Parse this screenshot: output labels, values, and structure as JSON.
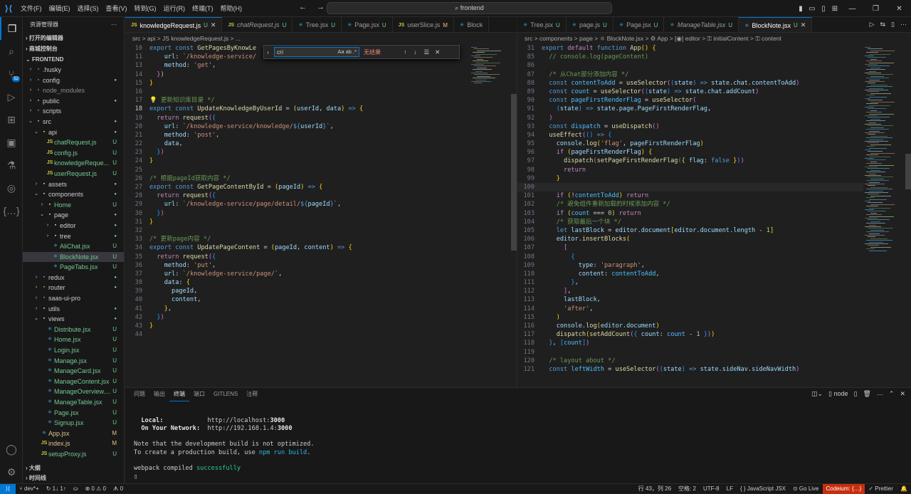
{
  "titlebar": {
    "menu": [
      "文件(F)",
      "编辑(E)",
      "选择(S)",
      "查看(V)",
      "转到(G)",
      "运行(R)",
      "终端(T)",
      "帮助(H)"
    ],
    "search": "frontend"
  },
  "activity": {
    "badge": "52"
  },
  "sidebar": {
    "title": "资源管理器",
    "sections": {
      "open_editors": "打开的编辑器",
      "workspace": "商城控制台",
      "project": "FRONTEND",
      "outline": "大纲",
      "timeline": "时间线"
    },
    "tree": [
      {
        "d": 0,
        "a": ">",
        "i": "▪",
        "ic": "#6d8086",
        "l": ".husky",
        "s": ""
      },
      {
        "d": 0,
        "a": ">",
        "i": "▪",
        "ic": "#6d8086",
        "l": "config",
        "s": "dot"
      },
      {
        "d": 0,
        "a": ">",
        "i": "▪",
        "ic": "#6d8086",
        "l": "node_modules",
        "s": "",
        "cls": "dim"
      },
      {
        "d": 0,
        "a": ">",
        "i": "▪",
        "ic": "#73c991",
        "l": "public",
        "s": "dot"
      },
      {
        "d": 0,
        "a": ">",
        "i": "▪",
        "ic": "#6d8086",
        "l": "scripts",
        "s": ""
      },
      {
        "d": 0,
        "a": "v",
        "i": "▪",
        "ic": "#73c991",
        "l": "src",
        "s": "dot"
      },
      {
        "d": 1,
        "a": "v",
        "i": "▪",
        "ic": "#cbcb41",
        "l": "api",
        "s": "dot"
      },
      {
        "d": 2,
        "a": "",
        "i": "JS",
        "ic": "#cbcb41",
        "l": "chatRequest.js",
        "s": "U",
        "cls": "U"
      },
      {
        "d": 2,
        "a": "",
        "i": "JS",
        "ic": "#cbcb41",
        "l": "config.js",
        "s": "U",
        "cls": "U"
      },
      {
        "d": 2,
        "a": "",
        "i": "JS",
        "ic": "#cbcb41",
        "l": "knowledgeReque...",
        "s": "U",
        "cls": "U"
      },
      {
        "d": 2,
        "a": "",
        "i": "JS",
        "ic": "#cbcb41",
        "l": "userRequest.js",
        "s": "U",
        "cls": "U"
      },
      {
        "d": 1,
        "a": ">",
        "i": "▪",
        "ic": "#e2c08d",
        "l": "assets",
        "s": "dot"
      },
      {
        "d": 1,
        "a": "v",
        "i": "▪",
        "ic": "#e2c08d",
        "l": "components",
        "s": "dot"
      },
      {
        "d": 2,
        "a": ">",
        "i": "▪",
        "ic": "#e2c08d",
        "l": "Home",
        "s": "U",
        "cls": "U"
      },
      {
        "d": 2,
        "a": "v",
        "i": "▪",
        "ic": "#e2c08d",
        "l": "page",
        "s": "dot"
      },
      {
        "d": 3,
        "a": ">",
        "i": "▪",
        "ic": "#e2c08d",
        "l": "editor",
        "s": "dot"
      },
      {
        "d": 3,
        "a": ">",
        "i": "▪",
        "ic": "#e2c08d",
        "l": "tree",
        "s": "dot"
      },
      {
        "d": 3,
        "a": "",
        "i": "⚛",
        "ic": "#4fc1ff",
        "l": "AliChat.jsx",
        "s": "U",
        "cls": "U"
      },
      {
        "d": 3,
        "a": "",
        "i": "⚛",
        "ic": "#4fc1ff",
        "l": "BlockNote.jsx",
        "s": "U",
        "cls": "U",
        "sel": true
      },
      {
        "d": 3,
        "a": "",
        "i": "⚛",
        "ic": "#4fc1ff",
        "l": "PageTabs.jsx",
        "s": "U",
        "cls": "U"
      },
      {
        "d": 1,
        "a": ">",
        "i": "▪",
        "ic": "#a074c4",
        "l": "redux",
        "s": "dot"
      },
      {
        "d": 1,
        "a": ">",
        "i": "▪",
        "ic": "#e37933",
        "l": "router",
        "s": "dot"
      },
      {
        "d": 1,
        "a": ">",
        "i": "▪",
        "ic": "#6d8086",
        "l": "saas-ui-pro",
        "s": ""
      },
      {
        "d": 1,
        "a": ">",
        "i": "▪",
        "ic": "#e2c08d",
        "l": "utils",
        "s": "dot"
      },
      {
        "d": 1,
        "a": "v",
        "i": "▪",
        "ic": "#e2c08d",
        "l": "views",
        "s": "dot"
      },
      {
        "d": 2,
        "a": "",
        "i": "⚛",
        "ic": "#4fc1ff",
        "l": "Distribute.jsx",
        "s": "U",
        "cls": "U"
      },
      {
        "d": 2,
        "a": "",
        "i": "⚛",
        "ic": "#4fc1ff",
        "l": "Home.jsx",
        "s": "U",
        "cls": "U"
      },
      {
        "d": 2,
        "a": "",
        "i": "⚛",
        "ic": "#4fc1ff",
        "l": "Login.jsx",
        "s": "U",
        "cls": "U"
      },
      {
        "d": 2,
        "a": "",
        "i": "⚛",
        "ic": "#4fc1ff",
        "l": "Manage.jsx",
        "s": "U",
        "cls": "U"
      },
      {
        "d": 2,
        "a": "",
        "i": "⚛",
        "ic": "#4fc1ff",
        "l": "ManageCard.jsx",
        "s": "U",
        "cls": "U"
      },
      {
        "d": 2,
        "a": "",
        "i": "⚛",
        "ic": "#4fc1ff",
        "l": "ManageContent.jsx",
        "s": "U",
        "cls": "U"
      },
      {
        "d": 2,
        "a": "",
        "i": "⚛",
        "ic": "#4fc1ff",
        "l": "ManageOverview....",
        "s": "U",
        "cls": "U"
      },
      {
        "d": 2,
        "a": "",
        "i": "⚛",
        "ic": "#4fc1ff",
        "l": "ManageTable.jsx",
        "s": "U",
        "cls": "U"
      },
      {
        "d": 2,
        "a": "",
        "i": "⚛",
        "ic": "#4fc1ff",
        "l": "Page.jsx",
        "s": "U",
        "cls": "U"
      },
      {
        "d": 2,
        "a": "",
        "i": "⚛",
        "ic": "#4fc1ff",
        "l": "Signup.jsx",
        "s": "U",
        "cls": "U"
      },
      {
        "d": 1,
        "a": "",
        "i": "⚛",
        "ic": "#4fc1ff",
        "l": "App.jsx",
        "s": "M",
        "cls": "M"
      },
      {
        "d": 1,
        "a": "",
        "i": "JS",
        "ic": "#cbcb41",
        "l": "index.js",
        "s": "M",
        "cls": "M"
      },
      {
        "d": 1,
        "a": "",
        "i": "JS",
        "ic": "#cbcb41",
        "l": "setupProxy.js",
        "s": "U",
        "cls": "U"
      }
    ]
  },
  "tabs_left": [
    {
      "i": "JS",
      "l": "knowledgeRequest.js",
      "s": "U",
      "active": true,
      "close": true
    },
    {
      "i": "JS",
      "l": "chatRequest.js",
      "s": "U",
      "it": true
    },
    {
      "i": "⚛",
      "l": "Tree.jsx",
      "s": "U"
    },
    {
      "i": "⚛",
      "l": "Page.jsx",
      "s": "U"
    },
    {
      "i": "JS",
      "l": "userSlice.js",
      "s": "M"
    },
    {
      "i": "⚛",
      "l": "Block",
      "s": ""
    }
  ],
  "tabs_right": [
    {
      "i": "⚛",
      "l": "Tree.jsx",
      "s": "U"
    },
    {
      "i": "⚛",
      "l": "page.js",
      "s": "U"
    },
    {
      "i": "⚛",
      "l": "Page.jsx",
      "s": "U"
    },
    {
      "i": "⚛",
      "l": "ManageTable.jsx",
      "s": "U",
      "it": true
    },
    {
      "i": "⚛",
      "l": "BlockNote.jsx",
      "s": "U",
      "active": true,
      "close": true
    }
  ],
  "breadcrumb_left": "src > api > JS knowledgeRequest.js > ...",
  "breadcrumb_right": "src > components > page > ⚛ BlockNote.jsx > ⚙ App > [◉] editor > ⚿ initialContent > ⚿ content",
  "find": {
    "value": "cri",
    "options": "Aa  ab  .*",
    "result": "无结果"
  },
  "code_left": [
    {
      "n": "10",
      "h": "<span class='k'>export</span> <span class='k'>const</span> <span class='f'>GetPagesByKnowLe</span>"
    },
    {
      "n": "11",
      "h": "    <span class='v'>url</span>: <span class='s'>`/knowledge-service/</span>"
    },
    {
      "n": "13",
      "h": "    <span class='v'>method</span>: <span class='s'>'get'</span>,"
    },
    {
      "n": "14",
      "h": "  <span class='pu'>}</span>)"
    },
    {
      "n": "15",
      "h": "<span class='y'>}</span>"
    },
    {
      "n": "16",
      "h": ""
    },
    {
      "n": "17",
      "h": "<span class='y'>💡</span> <span class='c'>更新知识库目录 */</span>"
    },
    {
      "n": "18",
      "h": "<span class='k'>export</span> <span class='k'>const</span> <span class='f'>UpdateKnowledgeByUserId</span> = <span class='y'>(</span><span class='v'>userId</span>, <span class='v'>data</span><span class='y'>)</span> <span class='k'>=&gt;</span> <span class='y'>{</span>",
      "cur": true
    },
    {
      "n": "19",
      "h": "  <span class='kc'>return</span> <span class='f'>request</span><span class='pu'>(</span><span class='bl'>{</span>"
    },
    {
      "n": "20",
      "h": "    <span class='v'>url</span>: <span class='s'>`/knowledge-service/knowledge/</span><span class='k'>${</span><span class='v'>userId</span><span class='k'>}</span><span class='s'>`</span>,"
    },
    {
      "n": "21",
      "h": "    <span class='v'>method</span>: <span class='s'>'post'</span>,"
    },
    {
      "n": "22",
      "h": "    <span class='v'>data</span>,"
    },
    {
      "n": "23",
      "h": "  <span class='bl'>}</span><span class='pu'>)</span>"
    },
    {
      "n": "24",
      "h": "<span class='y'>}</span>"
    },
    {
      "n": "25",
      "h": ""
    },
    {
      "n": "26",
      "h": "<span class='c'>/* 根据pageId获取内容 */</span>"
    },
    {
      "n": "27",
      "h": "<span class='k'>export</span> <span class='k'>const</span> <span class='f'>GetPageContentById</span> = <span class='y'>(</span><span class='v'>pageId</span><span class='y'>)</span> <span class='k'>=&gt;</span> <span class='y'>{</span>"
    },
    {
      "n": "28",
      "h": "  <span class='kc'>return</span> <span class='f'>request</span><span class='pu'>(</span><span class='bl'>{</span>"
    },
    {
      "n": "29",
      "h": "    <span class='v'>url</span>: <span class='s'>`/knowledge-service/page/detail/</span><span class='k'>${</span><span class='v'>pageId</span><span class='k'>}</span><span class='s'>`</span>,"
    },
    {
      "n": "30",
      "h": "  <span class='bl'>}</span><span class='pu'>)</span>"
    },
    {
      "n": "31",
      "h": "<span class='y'>}</span>"
    },
    {
      "n": "32",
      "h": ""
    },
    {
      "n": "33",
      "h": "<span class='c'>/* 更新page内容 */</span>"
    },
    {
      "n": "34",
      "h": "<span class='k'>export</span> <span class='k'>const</span> <span class='f'>UpdatePageContent</span> = <span class='y'>(</span><span class='v'>pageId</span>, <span class='v'>content</span><span class='y'>)</span> <span class='k'>=&gt;</span> <span class='y'>{</span>"
    },
    {
      "n": "35",
      "h": "  <span class='kc'>return</span> <span class='f'>request</span><span class='pu'>(</span><span class='bl'>{</span>"
    },
    {
      "n": "36",
      "h": "    <span class='v'>method</span>: <span class='s'>'put'</span>,"
    },
    {
      "n": "37",
      "h": "    <span class='v'>url</span>: <span class='s'>`/knowledge-service/page/`</span>,"
    },
    {
      "n": "38",
      "h": "    <span class='v'>data</span>: <span class='y'>{</span>"
    },
    {
      "n": "39",
      "h": "      <span class='v'>pageId</span>,"
    },
    {
      "n": "40",
      "h": "      <span class='v'>content</span>,"
    },
    {
      "n": "41",
      "h": "    <span class='y'>}</span>,"
    },
    {
      "n": "42",
      "h": "  <span class='bl'>}</span><span class='pu'>)</span>"
    },
    {
      "n": "43",
      "h": "<span class='y'>}</span>"
    },
    {
      "n": "44",
      "h": ""
    }
  ],
  "code_right": [
    {
      "n": "31",
      "h": "<span class='k'>export</span> <span class='kc'>default</span> <span class='k'>function</span> <span class='f'>App</span><span class='y'>()</span> <span class='y'>{</span>"
    },
    {
      "n": "85",
      "h": "  <span class='c'>// console.log(pageContent)</span>"
    },
    {
      "n": "86",
      "h": ""
    },
    {
      "n": "87",
      "h": "  <span class='c'>/* 从Chat部分添加内容 */</span>"
    },
    {
      "n": "88",
      "h": "  <span class='k'>const</span> <span class='cn'>contentToAdd</span> = <span class='f'>useSelector</span><span class='pu'>(</span><span class='bl'>(</span><span class='v'>state</span><span class='bl'>)</span> <span class='k'>=&gt;</span> <span class='v'>state</span>.<span class='v'>chat</span>.<span class='v'>contentToAdd</span><span class='pu'>)</span>"
    },
    {
      "n": "89",
      "h": "  <span class='k'>const</span> <span class='cn'>count</span> = <span class='f'>useSelector</span><span class='pu'>(</span><span class='bl'>(</span><span class='v'>state</span><span class='bl'>)</span> <span class='k'>=&gt;</span> <span class='v'>state</span>.<span class='v'>chat</span>.<span class='v'>addCount</span><span class='pu'>)</span>"
    },
    {
      "n": "90",
      "h": "  <span class='k'>const</span> <span class='cn'>pageFirstRenderFlag</span> = <span class='f'>useSelector</span><span class='pu'>(</span>"
    },
    {
      "n": "91",
      "h": "    <span class='bl'>(</span><span class='v'>state</span><span class='bl'>)</span> <span class='k'>=&gt;</span> <span class='v'>state</span>.<span class='v'>page</span>.<span class='v'>PageFirstRenderFlag</span>,"
    },
    {
      "n": "92",
      "h": "  <span class='pu'>)</span>"
    },
    {
      "n": "93",
      "h": "  <span class='k'>const</span> <span class='cn'>dispatch</span> = <span class='f'>useDispatch</span><span class='pu'>()</span>"
    },
    {
      "n": "94",
      "h": "  <span class='f'>useEffect</span><span class='pu'>(</span><span class='bl'>()</span> <span class='k'>=&gt;</span> <span class='bl'>{</span>"
    },
    {
      "n": "95",
      "h": "    <span class='v'>console</span>.<span class='f'>log</span><span class='y'>(</span><span class='s'>'flag'</span>, <span class='v'>pageFirstRenderFlag</span><span class='y'>)</span>"
    },
    {
      "n": "96",
      "h": "    <span class='kc'>if</span> <span class='y'>(</span><span class='v'>pageFirstRenderFlag</span><span class='y'>)</span> <span class='y'>{</span>"
    },
    {
      "n": "97",
      "h": "      <span class='f'>dispatch</span><span class='pu'>(</span><span class='f'>setPageFirstRenderFlag</span><span class='bl'>(</span><span class='y'>{</span> <span class='v'>flag</span>: <span class='k'>false</span> <span class='y'>}</span><span class='bl'>)</span><span class='pu'>)</span>"
    },
    {
      "n": "98",
      "h": "      <span class='kc'>return</span>"
    },
    {
      "n": "99",
      "h": "    <span class='y'>}</span>"
    },
    {
      "n": "100",
      "h": "",
      "hl": true
    },
    {
      "n": "101",
      "h": "    <span class='kc'>if</span> <span class='y'>(</span>!<span class='cn'>contentToAdd</span><span class='y'>)</span> <span class='kc'>return</span>"
    },
    {
      "n": "102",
      "h": "    <span class='c'>/* 避免组件重新加载的时候添加内容 */</span>"
    },
    {
      "n": "103",
      "h": "    <span class='kc'>if</span> <span class='y'>(</span><span class='cn'>count</span> === <span class='n'>0</span><span class='y'>)</span> <span class='kc'>return</span>"
    },
    {
      "n": "104",
      "h": "    <span class='c'>/* 获取最后一个块 */</span>"
    },
    {
      "n": "105",
      "h": "    <span class='k'>let</span> <span class='v'>lastBlock</span> = <span class='v'>editor</span>.<span class='v'>document</span><span class='y'>[</span><span class='v'>editor</span>.<span class='v'>document</span>.<span class='v'>length</span> - <span class='n'>1</span><span class='y'>]</span>"
    },
    {
      "n": "106",
      "h": "    <span class='v'>editor</span>.<span class='f'>insertBlocks</span><span class='y'>(</span>"
    },
    {
      "n": "107",
      "h": "      <span class='pu'>[</span>"
    },
    {
      "n": "108",
      "h": "        <span class='bl'>{</span>"
    },
    {
      "n": "109",
      "h": "          <span class='v'>type</span>: <span class='s'>'paragraph'</span>,"
    },
    {
      "n": "110",
      "h": "          <span class='v'>content</span>: <span class='cn'>contentToAdd</span>,"
    },
    {
      "n": "111",
      "h": "        <span class='bl'>}</span>,"
    },
    {
      "n": "112",
      "h": "      <span class='pu'>]</span>,"
    },
    {
      "n": "113",
      "h": "      <span class='v'>lastBlock</span>,"
    },
    {
      "n": "114",
      "h": "      <span class='s'>'after'</span>,"
    },
    {
      "n": "115",
      "h": "    <span class='y'>)</span>"
    },
    {
      "n": "116",
      "h": "    <span class='v'>console</span>.<span class='f'>log</span><span class='y'>(</span><span class='v'>editor</span>.<span class='v'>document</span><span class='y'>)</span>"
    },
    {
      "n": "117",
      "h": "    <span class='f'>dispatch</span><span class='y'>(</span><span class='f'>setAddCount</span><span class='pu'>(</span><span class='bl'>{</span> <span class='v'>count</span>: <span class='cn'>count</span> - <span class='n'>1</span> <span class='bl'>}</span><span class='pu'>)</span><span class='y'>)</span>"
    },
    {
      "n": "118",
      "h": "  <span class='bl'>}</span>, <span class='bl'>[</span><span class='cn'>count</span><span class='bl'>]</span><span class='pu'>)</span>"
    },
    {
      "n": "119",
      "h": ""
    },
    {
      "n": "120",
      "h": "  <span class='c'>/* layout about */</span>"
    },
    {
      "n": "121",
      "h": "  <span class='k'>const</span> <span class='cn'>leftWidth</span> = <span class='f'>useSelector</span><span class='pu'>(</span><span class='bl'>(</span><span class='v'>state</span><span class='bl'>)</span> <span class='k'>=&gt;</span> <span class='v'>state</span>.<span class='v'>sideNav</span>.<span class='v'>sideNavWidth</span><span class='pu'>)</span>"
    }
  ],
  "panel": {
    "tabs": [
      "问题",
      "输出",
      "终端",
      "端口",
      "GITLENS",
      "注释"
    ],
    "active": 2,
    "shell": "node",
    "lines": [
      {
        "h": ""
      },
      {
        "h": ""
      },
      {
        "h": "  <span class='tb'>Local:</span>            http://localhost:<span class='tb'>3000</span>"
      },
      {
        "h": "  <span class='tb'>On Your Network:</span>  http://192.168.1.4:<span class='tb'>3000</span>"
      },
      {
        "h": ""
      },
      {
        "h": "Note that the development build is not optimized."
      },
      {
        "h": "To create a production build, use <span class='tc'>npm run build</span>."
      },
      {
        "h": ""
      },
      {
        "h": "webpack compiled <span class='tg'>successfully</span>"
      },
      {
        "h": "▯"
      }
    ]
  },
  "status": {
    "branch": "dev*+",
    "sync": "↻ 1↓ 1↑",
    "errors": "⊗ 0 ⚠ 0",
    "ports": "ᗑ 0",
    "position": "行 43，列 26",
    "spaces": "空格: 2",
    "encoding": "UTF-8",
    "eol": "LF",
    "language": "{ } JavaScript JSX",
    "golive": "⊙ Go Live",
    "codeium": "Codeium: {…}",
    "prettier": "✓ Prettier"
  }
}
